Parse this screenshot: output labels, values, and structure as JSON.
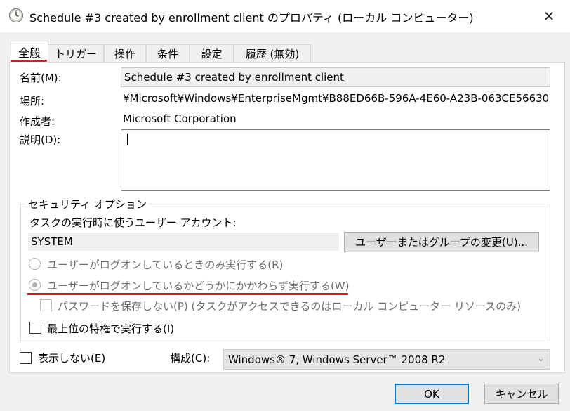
{
  "window": {
    "title": "Schedule #3 created by enrollment client のプロパティ (ローカル コンピューター)",
    "title_icon": "clock-icon",
    "close_label": "✕"
  },
  "tabs": [
    {
      "label": "全般",
      "active": true
    },
    {
      "label": "トリガー",
      "active": false
    },
    {
      "label": "操作",
      "active": false
    },
    {
      "label": "条件",
      "active": false
    },
    {
      "label": "設定",
      "active": false
    },
    {
      "label": "履歴 (無効)",
      "active": false
    }
  ],
  "general": {
    "name_label": "名前(M):",
    "name_value": "Schedule #3 created by enrollment client",
    "location_label": "場所:",
    "location_value": "¥Microsoft¥Windows¥EnterpriseMgmt¥B88ED66B-596A-4E60-A23B-063CE56630E",
    "author_label": "作成者:",
    "author_value": "Microsoft Corporation",
    "description_label": "説明(D):",
    "description_value": ""
  },
  "security": {
    "group_title": "セキュリティ オプション",
    "account_label": "タスクの実行時に使うユーザー アカウント:",
    "account_value": "SYSTEM",
    "change_button": "ユーザーまたはグループの変更(U)...",
    "radio_logged_on": "ユーザーがログオンしているときのみ実行する(R)",
    "radio_whether": "ユーザーがログオンしているかどうかにかかわらず実行する(W)",
    "no_password": "パスワードを保存しない(P) (タスクがアクセスできるのはローカル コンピューター リソースのみ)",
    "highest_privileges": "最上位の特権で実行する(I)"
  },
  "bottom": {
    "hidden_label": "表示しない(E)",
    "configure_label": "構成(C):",
    "configure_value": "Windows® 7, Windows Server™ 2008 R2"
  },
  "buttons": {
    "ok": "OK",
    "cancel": "キャンセル"
  },
  "colors": {
    "accent": "#0078d7",
    "annotation_red": "#e81123"
  }
}
